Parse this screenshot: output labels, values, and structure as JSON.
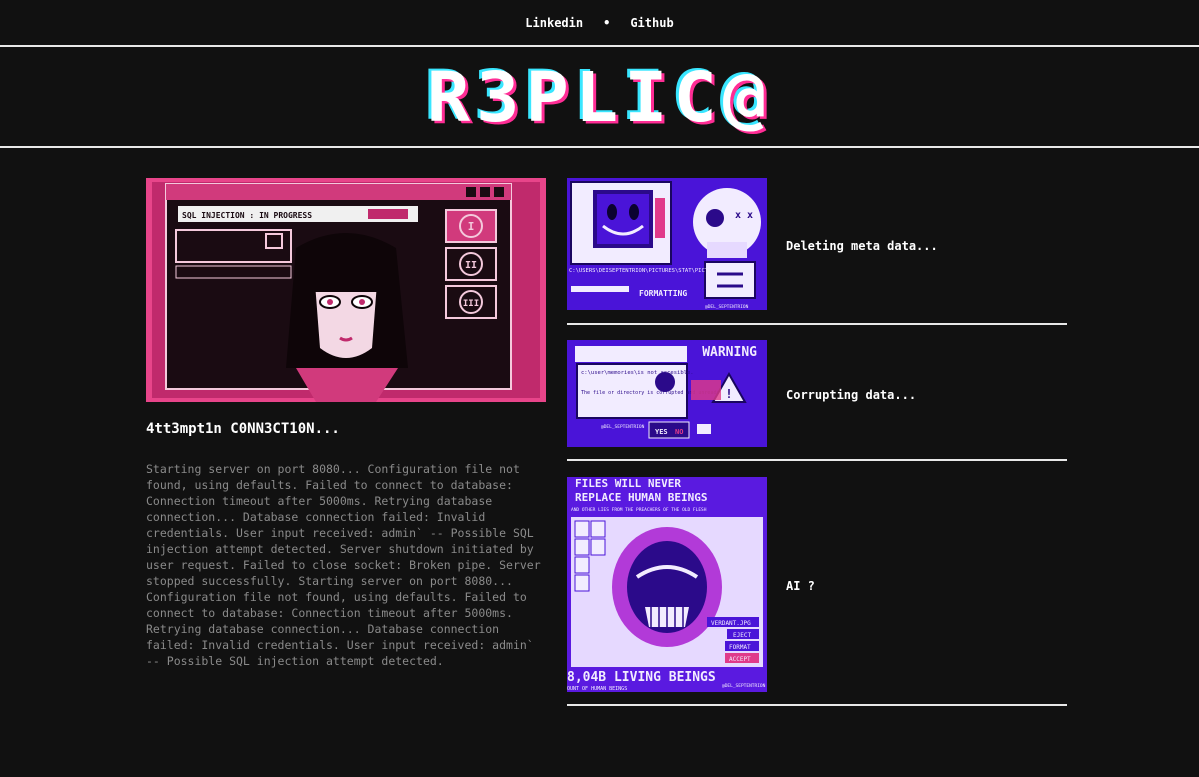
{
  "nav": {
    "links": [
      {
        "label": "Linkedin"
      },
      {
        "label": "Github"
      }
    ],
    "separator": "•"
  },
  "logo": {
    "text": "R3PLIC@"
  },
  "feature": {
    "title": "4tt3mpt1n C0NN3CT10N...",
    "body": "Starting server on port 8080... Configuration file not found, using defaults. Failed to connect to database: Connection timeout after 5000ms. Retrying database connection... Database connection failed: Invalid credentials. User input received: admin` -- Possible SQL injection attempt detected. Server shutdown initiated by user request. Failed to close socket: Broken pipe. Server stopped successfully. Starting server on port 8080... Configuration file not found, using defaults. Failed to connect to database: Connection timeout after 5000ms. Retrying database connection... Database connection failed: Invalid credentials. User input received: admin` -- Possible SQL injection attempt detected.",
    "image": {
      "window_text": "SQL INJECTION : IN PROGRESS",
      "buttons": [
        "I",
        "II",
        "III"
      ]
    }
  },
  "items": [
    {
      "label": "Deleting meta data...",
      "image": {
        "path_text": "C:\\USERS\\DEISEPTENTRION\\PICTURES\\STAT\\PICTURE06.PNG",
        "status_text": "FORMATTING",
        "credit": "@DEL_SEPTENTRION"
      }
    },
    {
      "label": "Corrupting data...",
      "image": {
        "header": "WARNING",
        "msg1": "c:\\user\\memories\\is not accesible.",
        "msg2": "The file or directory is corrupted and unreadable.",
        "banner": "FORMAT CORRUPTED PARTITION?",
        "yes": "YES",
        "no": "NO",
        "credit": "@DEL_SEPTENTRION"
      }
    },
    {
      "label": "AI ?",
      "image": {
        "top1": "FILES WILL NEVER",
        "top2": "REPLACE HUMAN BEINGS",
        "top3": "AND OTHER LIES FROM THE PREACHERS OF THE OLD FLESH",
        "file": "VERDANT.JPG",
        "opt1": "EJECT",
        "opt2": "FORMAT",
        "opt3": "ACCEPT",
        "bottom": "8,04B LIVING BEINGS",
        "bottom2": "OUNT OF HUMAN BEINGS",
        "credit": "@DEL_SEPTENTRION"
      }
    }
  ],
  "colors": {
    "background": "#111111",
    "magenta": "#ff2d95",
    "cyan": "#39e6ff",
    "purple": "#4a14d8",
    "rule": "#e8e8e8",
    "body_text": "#8a8a8a"
  }
}
